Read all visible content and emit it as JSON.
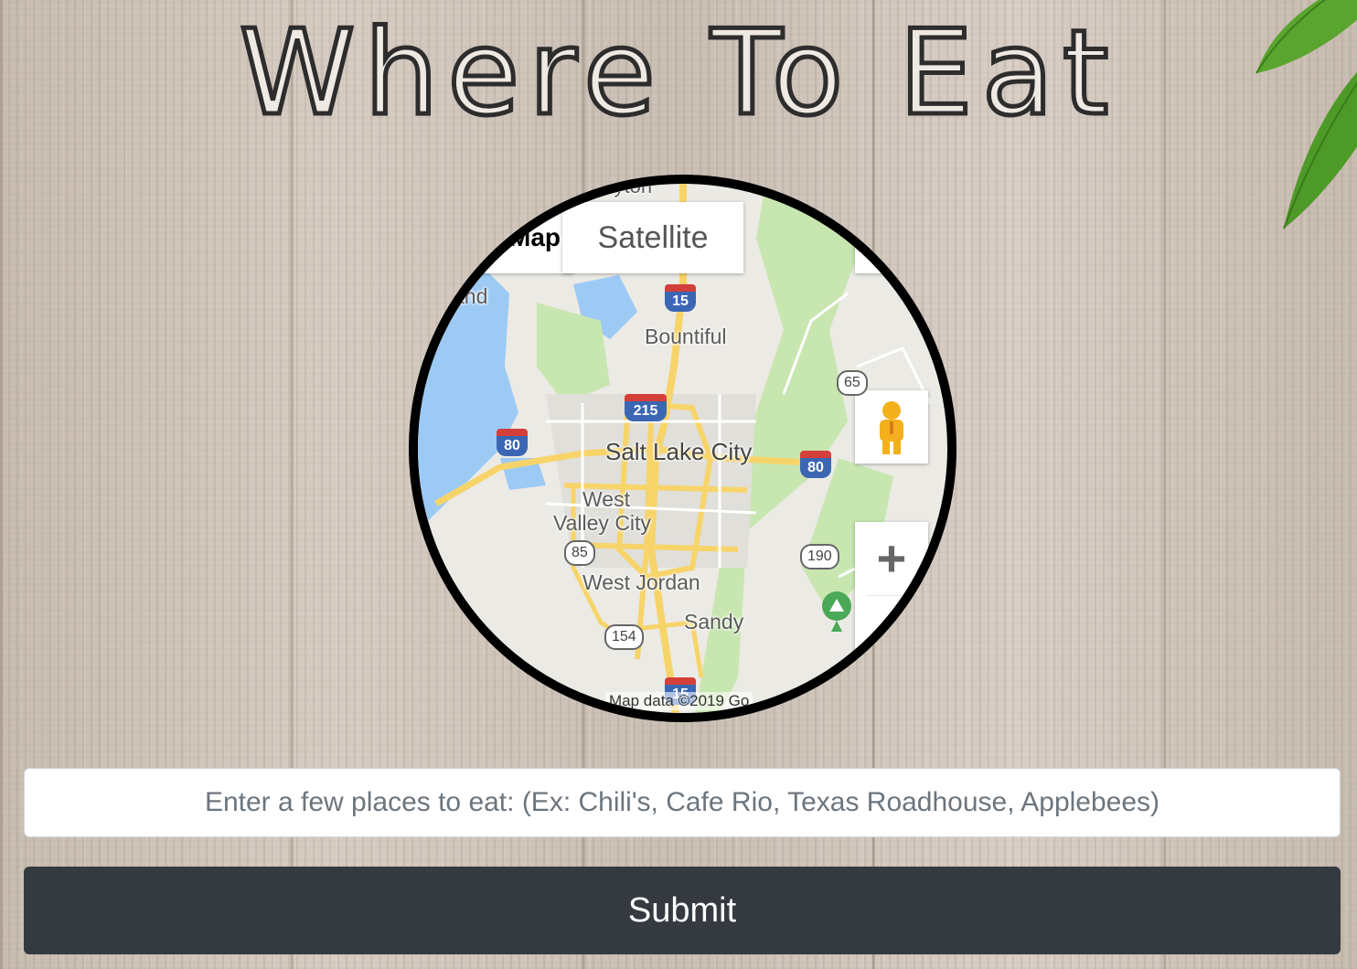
{
  "page": {
    "title": "Where To Eat"
  },
  "map": {
    "type_control": {
      "map_label": "Map",
      "satellite_label": "Satellite"
    },
    "labels": {
      "bountiful": "Bountiful",
      "salt_lake_city": "Salt Lake City",
      "west_valley_line1": "West",
      "west_valley_line2": "Valley City",
      "west_jordan": "West Jordan",
      "sandy": "Sandy",
      "layton_fragment": "Layton",
      "island_fragment": "and"
    },
    "shields": {
      "i15_north": "15",
      "i215": "215",
      "i80_west": "80",
      "i80_east": "80",
      "i15_south": "15",
      "sr65": "65",
      "sr190": "190",
      "sr85": "85",
      "sr154": "154"
    },
    "attribution": "Map data ©2019 Go",
    "zoom_in_label": "+"
  },
  "form": {
    "input_placeholder": "Enter a few places to eat: (Ex: Chili's, Cafe Rio, Texas Roadhouse, Applebees)",
    "input_value": "",
    "submit_label": "Submit"
  },
  "colors": {
    "button_bg": "#343a40",
    "water": "#9ccaf5",
    "park": "#c8e6b0",
    "highway": "#f7d46a"
  }
}
